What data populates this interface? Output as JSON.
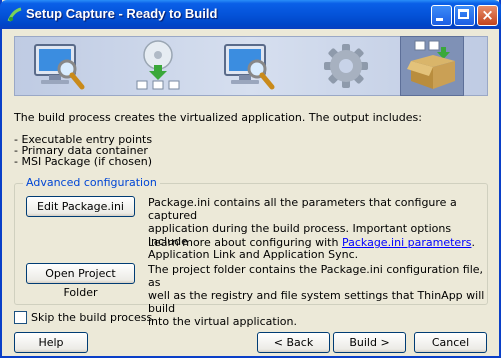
{
  "window": {
    "title": "Setup Capture - Ready to Build"
  },
  "steps": [
    {
      "name": "monitor-search-icon",
      "active": false
    },
    {
      "name": "disc-install-icon",
      "active": false
    },
    {
      "name": "monitor-search-icon",
      "active": false
    },
    {
      "name": "gear-icon",
      "active": false
    },
    {
      "name": "package-box-icon",
      "active": true
    }
  ],
  "intro": {
    "line1": "The build process creates the virtualized application. The output includes:",
    "bullets": [
      "- Executable entry points",
      "- Primary data container",
      "- MSI Package (if chosen)"
    ]
  },
  "advanced": {
    "legend": "Advanced configuration",
    "edit_button": "Edit Package.ini",
    "edit_desc": [
      "Package.ini contains all the parameters that configure a captured",
      "application during the build process. Important options include",
      "Application Link and Application Sync."
    ],
    "learn_more_prefix": "Learn more about configuring with ",
    "learn_more_link": "Package.ini parameters",
    "learn_more_suffix": ".",
    "folder_button": "Open Project Folder",
    "folder_desc": [
      "The project folder contains the Package.ini configuration file, as",
      "well as the registry and file system settings that ThinApp will build",
      "into the virtual application."
    ]
  },
  "skip": {
    "label": "Skip the build process",
    "checked": false
  },
  "footer": {
    "help": "Help",
    "back": "< Back",
    "build": "Build >",
    "cancel": "Cancel"
  },
  "colors": {
    "title_bar": "#0453d9",
    "banner": "#c8d3e8",
    "link": "#0000ff",
    "legend": "#0046d5"
  }
}
